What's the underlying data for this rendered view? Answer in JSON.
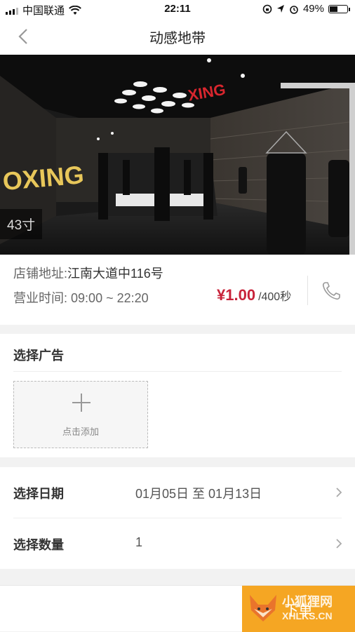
{
  "status_bar": {
    "carrier": "中国联通",
    "time": "22:11",
    "battery": "49%",
    "battery_level": 0.49,
    "icons": [
      "signal-icon",
      "wifi-icon",
      "rotation-lock-icon",
      "location-icon",
      "alarm-icon",
      "battery-icon"
    ]
  },
  "nav": {
    "title": "动感地带",
    "back_icon": "chevron-left-icon"
  },
  "hero": {
    "size_badge": "43寸",
    "sign_text": "OXING",
    "colors": {
      "sign": "#e8c75a",
      "red_sign": "#d8262e"
    }
  },
  "store": {
    "address_label": "店铺地址:",
    "address_value": "江南大道中116号",
    "hours_label": "营业时间:",
    "hours_value": "09:00 ~ 22:20",
    "price": "¥1.00",
    "price_unit": "/400秒",
    "phone_icon": "phone-icon"
  },
  "ad_section": {
    "title": "选择广告",
    "add_label": "点击添加",
    "add_icon": "plus-icon"
  },
  "selections": {
    "date_label": "选择日期",
    "date_value": "01月05日 至 01月13日",
    "qty_label": "选择数量",
    "qty_value": "1",
    "chevron_icon": "chevron-right-icon"
  },
  "bottom": {
    "order_label": "下单",
    "watermark_line1": "小狐狸网",
    "watermark_line2": "XHLKS.CN"
  },
  "colors": {
    "accent_price": "#c8233a",
    "order_button": "#f5a623",
    "background": "#f2f2f2"
  }
}
